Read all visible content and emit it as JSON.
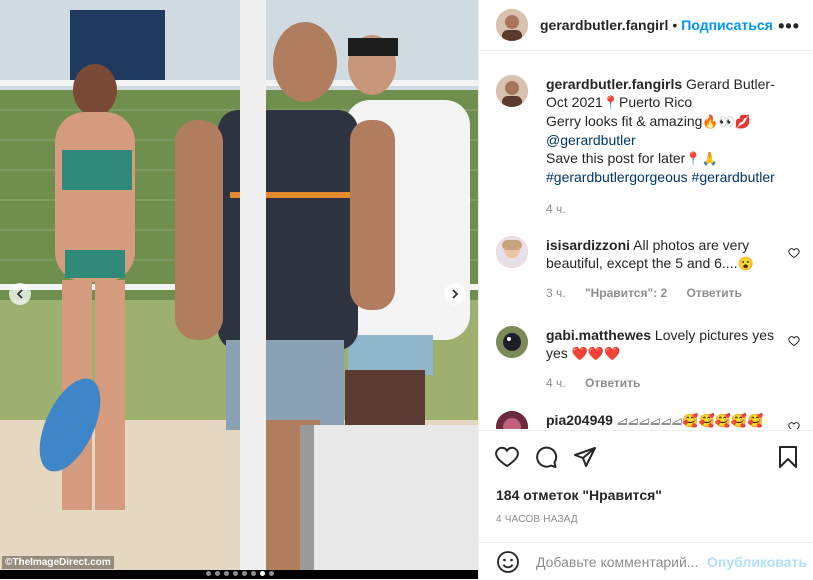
{
  "post": {
    "username": "gerardbutler.fangirl",
    "follow_label": "Подписаться",
    "separator": "•",
    "more": "•••",
    "photo_credit": "©TheImageDirect.com",
    "carousel": {
      "count": 8,
      "active_index": 6
    }
  },
  "caption": {
    "username": "gerardbutler.fangirls",
    "text_1": "Gerard Butler-Oct 2021",
    "emoji_1": "📍",
    "text_2": "Puerto Rico",
    "text_3": "Gerry looks fit & amazing",
    "emoji_2": "🔥👀💋",
    "mention": "@gerardbutler",
    "text_4": "Save this post for later",
    "emoji_3": "📍🙏",
    "hashtags": "#gerardbutlergorgeous #gerardbutler",
    "time": "4 ч."
  },
  "comments": [
    {
      "username": "isisardizzoni",
      "text": "All photos are very beautiful, except the 5 and 6....",
      "emoji": "😮",
      "time": "3 ч.",
      "likes": "\"Нравится\": 2",
      "reply": "Ответить"
    },
    {
      "username": "gabi.matthewes",
      "text": "Lovely pictures yes yes",
      "emoji": "❤️❤️❤️",
      "time": "4 ч.",
      "reply": "Ответить"
    },
    {
      "username": "pia204949",
      "text": "⧡⧡⧡⧡⧡⧡",
      "emoji": "🥰🥰🥰🥰🥰"
    }
  ],
  "actions": {
    "likes_text": "184 отметок \"Нравится\"",
    "time_ago": "4 часов назад"
  },
  "add_comment": {
    "placeholder": "Добавьте комментарий...",
    "publish_label": "Опубликовать"
  },
  "colors": {
    "link": "#00376b",
    "follow": "#0095f6",
    "publish_disabled": "#b2dffc",
    "meta": "#8e8e8e"
  }
}
